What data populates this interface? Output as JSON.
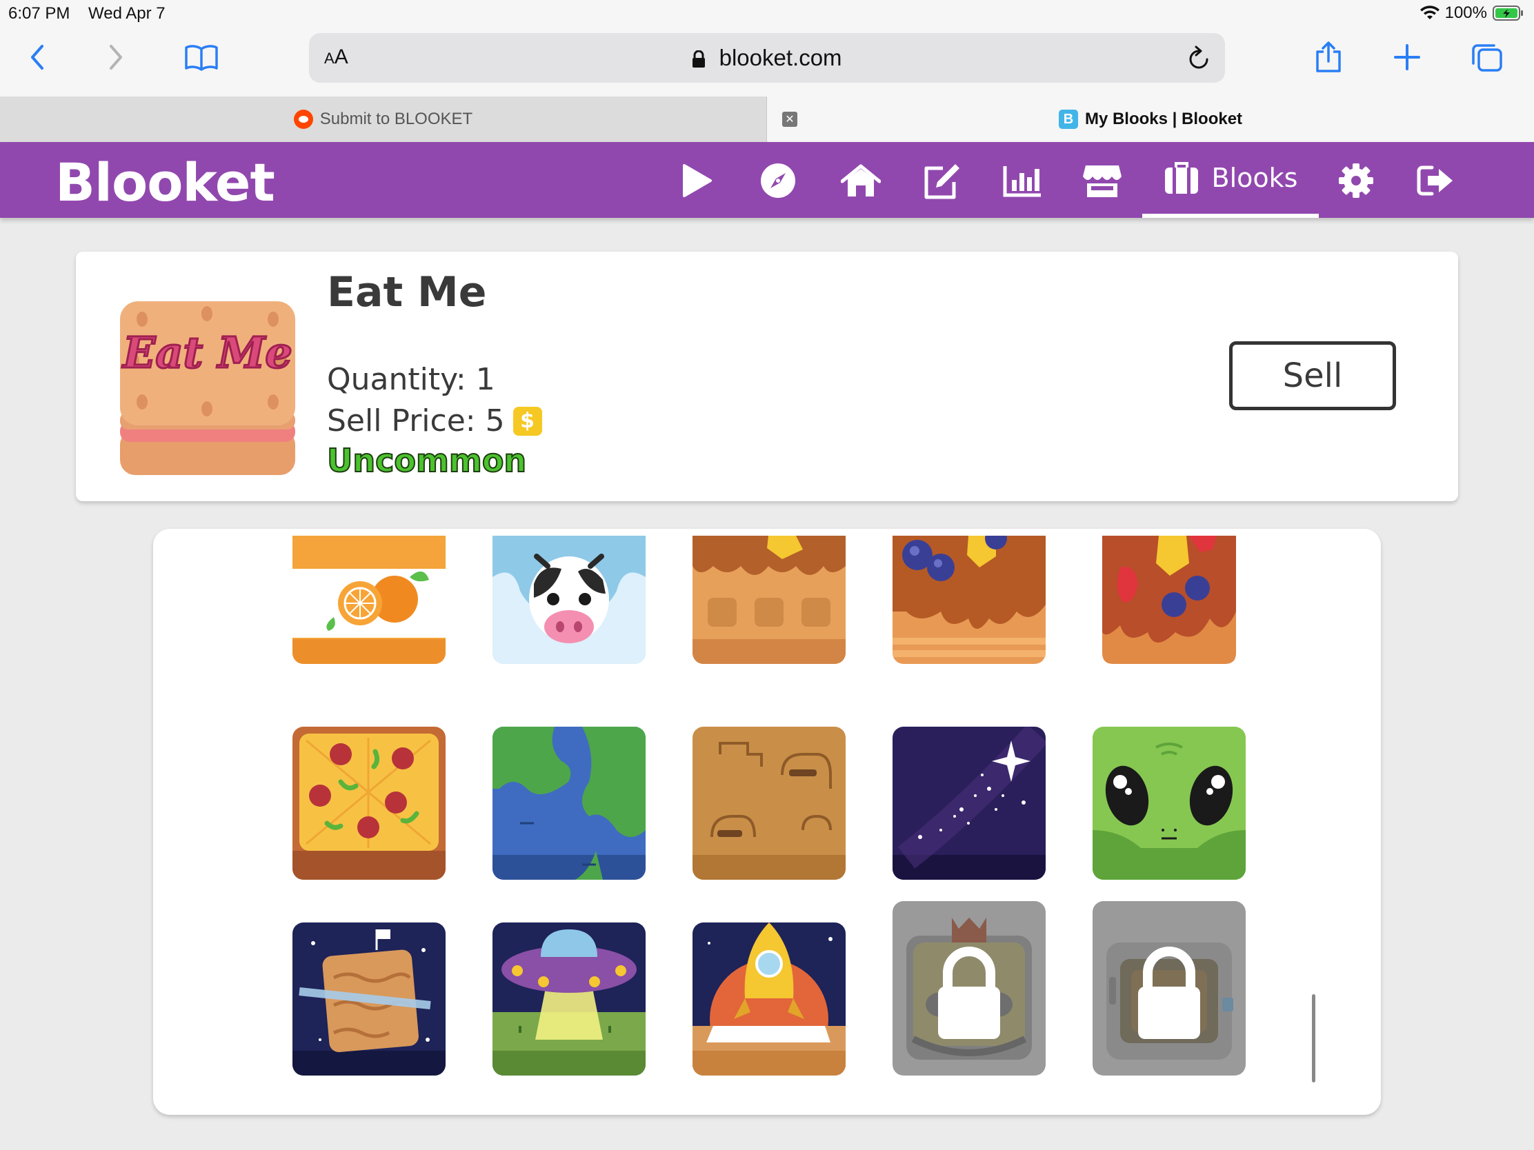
{
  "status": {
    "time": "6:07 PM",
    "date": "Wed Apr 7",
    "battery": "100%"
  },
  "browser": {
    "text_size_label": "AA",
    "url": "blooket.com",
    "tabs": [
      {
        "title": "Submit to BLOOKET",
        "active": false
      },
      {
        "title": "My Blooks | Blooket",
        "active": true
      }
    ]
  },
  "site": {
    "logo": "Blooket",
    "nav": [
      {
        "name": "play",
        "icon": "play-icon"
      },
      {
        "name": "discover",
        "icon": "compass-icon"
      },
      {
        "name": "home",
        "icon": "home-icon"
      },
      {
        "name": "create",
        "icon": "edit-icon"
      },
      {
        "name": "stats",
        "icon": "chart-icon"
      },
      {
        "name": "market",
        "icon": "store-icon"
      },
      {
        "name": "blooks",
        "icon": "briefcase-icon",
        "label": "Blooks",
        "active": true
      },
      {
        "name": "settings",
        "icon": "gear-icon"
      },
      {
        "name": "logout",
        "icon": "logout-icon"
      }
    ],
    "active_nav_label": "Blooks"
  },
  "selected_blook": {
    "name": "Eat Me",
    "image_text": "Eat Me",
    "quantity_text": "Quantity: 1",
    "sell_price_text": "Sell Price: 5",
    "coin_symbol": "$",
    "rarity": "Uncommon",
    "rarity_color": "#4bc22e",
    "sell_label": "Sell"
  },
  "blooks": [
    {
      "name": "orange-juice",
      "locked": false
    },
    {
      "name": "milk",
      "locked": false
    },
    {
      "name": "waffle",
      "locked": false
    },
    {
      "name": "pancakes",
      "locked": false
    },
    {
      "name": "french-toast",
      "locked": false
    },
    {
      "name": "pizza",
      "locked": false
    },
    {
      "name": "earth",
      "locked": false
    },
    {
      "name": "meteor",
      "locked": false
    },
    {
      "name": "stars",
      "locked": false
    },
    {
      "name": "alien",
      "locked": false
    },
    {
      "name": "planet",
      "locked": false
    },
    {
      "name": "ufo",
      "locked": false
    },
    {
      "name": "spaceship",
      "locked": false
    },
    {
      "name": "king-card",
      "locked": true
    },
    {
      "name": "robot",
      "locked": true
    }
  ],
  "colors": {
    "brand": "#9148ae",
    "accent_coin": "#f6c823"
  }
}
